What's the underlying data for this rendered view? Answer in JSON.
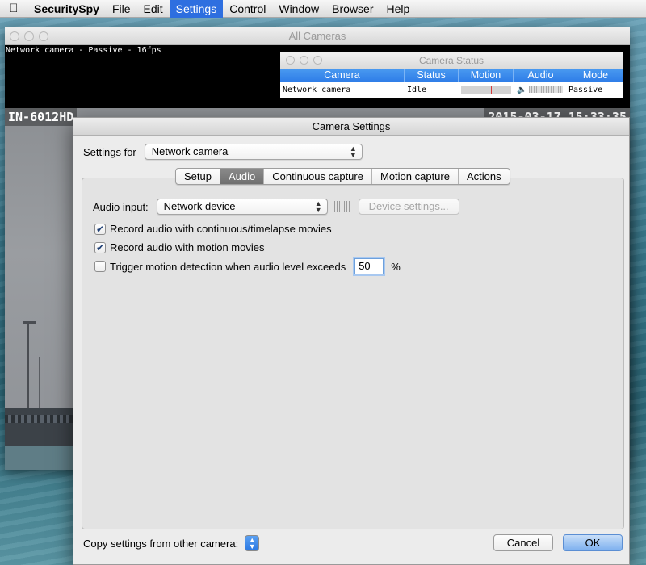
{
  "menubar": {
    "app_name": "SecuritySpy",
    "items": [
      "File",
      "Edit",
      "Settings",
      "Control",
      "Window",
      "Browser",
      "Help"
    ],
    "active_item": "Settings"
  },
  "all_cameras": {
    "title": "All Cameras",
    "feed_label": "Network camera - Passive - 16fps",
    "osd_left": "IN-6012HD",
    "osd_right": "2015-03-17 15:33:35"
  },
  "camera_status": {
    "title": "Camera Status",
    "columns": [
      "Camera",
      "Status",
      "Motion",
      "Audio",
      "Mode"
    ],
    "rows": [
      {
        "camera": "Network camera",
        "status": "Idle",
        "mode": "Passive"
      }
    ]
  },
  "settings": {
    "title": "Camera Settings",
    "settings_for_label": "Settings for",
    "settings_for_value": "Network camera",
    "tabs": [
      "Setup",
      "Audio",
      "Continuous capture",
      "Motion capture",
      "Actions"
    ],
    "selected_tab": "Audio",
    "audio_input_label": "Audio input:",
    "audio_input_value": "Network device",
    "device_settings_label": "Device settings...",
    "record_continuous_label": "Record audio with continuous/timelapse movies",
    "record_continuous_checked": true,
    "record_motion_label": "Record audio with motion movies",
    "record_motion_checked": true,
    "trigger_label": "Trigger motion detection when audio level exceeds",
    "trigger_checked": false,
    "trigger_value": "50",
    "trigger_unit": "%",
    "copy_label": "Copy settings from other camera:",
    "cancel_label": "Cancel",
    "ok_label": "OK"
  },
  "colors": {
    "accent": "#2e6fe0",
    "ok_button": "#7db0ef"
  }
}
